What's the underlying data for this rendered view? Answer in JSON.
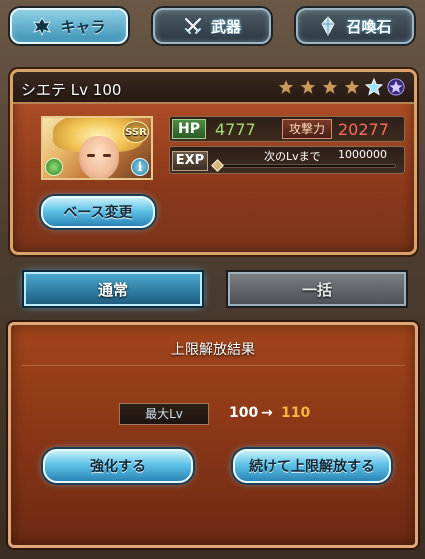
{
  "tabs": [
    {
      "label": "キャラ",
      "icon": "crest-icon",
      "active": true
    },
    {
      "label": "武器",
      "icon": "crossed-swords-icon",
      "active": false
    },
    {
      "label": "召喚石",
      "icon": "crystal-icon",
      "active": false
    }
  ],
  "character": {
    "name_level": "シエテ Lv 100",
    "rarity_badge": "SSR",
    "stars": [
      "bronze",
      "bronze",
      "bronze",
      "bronze",
      "blue",
      "purple"
    ],
    "hp_label": "HP",
    "hp_value": "4777",
    "atk_label": "攻撃力",
    "atk_value": "20277",
    "exp_label": "EXP",
    "next_level_label": "次のLvまで",
    "next_level_value": "1000000",
    "exp_progress": 0.0,
    "info_label": "i"
  },
  "base_change_button": "ベース変更",
  "modes": {
    "normal_label": "通常",
    "bulk_label": "一括",
    "active": "normal"
  },
  "result": {
    "title": "上限解放結果",
    "max_lv_label": "最大Lv",
    "lv_before": "100",
    "arrow": "→",
    "lv_after": "110",
    "enhance_button": "強化する",
    "continue_button": "続けて上限解放する"
  },
  "colors": {
    "hp_value": "#9fe06b",
    "atk_value": "#ff6a5c",
    "lv_after": "#f6b445",
    "accent_blue": "#5ec3e8",
    "panel": "#8a3616"
  }
}
